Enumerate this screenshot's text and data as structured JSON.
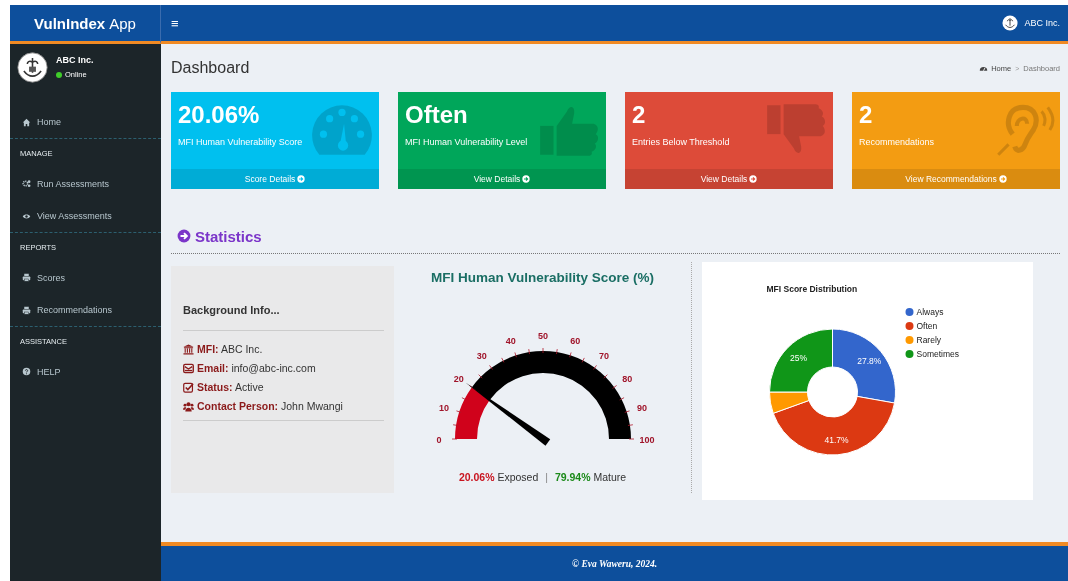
{
  "brand": {
    "bold": "VulnIndex",
    "rest": "App"
  },
  "topbar": {
    "menu_glyph": "≡",
    "user": "ABC Inc."
  },
  "sidebar": {
    "user": {
      "name": "ABC Inc.",
      "status": "Online",
      "online": true
    },
    "menu": [
      {
        "kind": "home",
        "label": "Home"
      },
      {
        "kind": "header",
        "label": "MANAGE"
      },
      {
        "kind": "gears",
        "label": "Run Assessments"
      },
      {
        "kind": "eye",
        "label": "View Assessments"
      },
      {
        "kind": "header",
        "label": "REPORTS"
      },
      {
        "kind": "print",
        "label": "Scores"
      },
      {
        "kind": "print",
        "label": "Recommendations"
      },
      {
        "kind": "header",
        "label": "ASSISTANCE"
      },
      {
        "kind": "help",
        "label": "HELP"
      }
    ]
  },
  "page": {
    "title": "Dashboard",
    "breadcrumb": [
      {
        "label": "Home"
      },
      {
        "label": "Dashboard"
      }
    ],
    "separator": ">"
  },
  "cards": [
    {
      "kind": "gauge",
      "value": "20.06%",
      "label": "MFI Human Vulnerability Score",
      "link": "Score Details",
      "color": "#00c0ef"
    },
    {
      "kind": "thumbs-up",
      "value": "Often",
      "label": "MFI Human Vulnerability Level",
      "link": "View Details",
      "color": "#00a65a"
    },
    {
      "kind": "thumbs-down",
      "value": "2",
      "label": "Entries Below Threshold",
      "link": "View Details",
      "color": "#dd4b39"
    },
    {
      "kind": "ear",
      "value": "2",
      "label": "Recommendations",
      "link": "View Recommendations",
      "color": "#f39c12"
    }
  ],
  "statistics": {
    "title": "Statistics"
  },
  "background_info": {
    "title": "Background Info...",
    "fields": [
      {
        "kind": "bank",
        "label": "MFI:",
        "value": "ABC Inc."
      },
      {
        "kind": "envelope",
        "label": "Email:",
        "value": "info@abc-inc.com"
      },
      {
        "kind": "check",
        "label": "Status:",
        "value": "Active"
      },
      {
        "kind": "users",
        "label": "Contact Person:",
        "value": "John Mwangi"
      }
    ]
  },
  "gauge": {
    "title": "MFI Human Vulnerability Score (%)",
    "level": 0.2006,
    "ticks": [
      "0",
      "10",
      "20",
      "30",
      "40",
      "50",
      "60",
      "70",
      "80",
      "90",
      "100"
    ],
    "exposed": {
      "value": "20.06%",
      "label": "Exposed"
    },
    "separator": "|",
    "mature": {
      "value": "79.94%",
      "label": "Mature"
    }
  },
  "distribution": {
    "chart_data": {
      "type": "donut",
      "title": "MFI Score Distribution",
      "categories": [
        "Always",
        "Often",
        "Rarely",
        "Sometimes"
      ],
      "values": [
        27.8,
        41.7,
        5.5,
        25
      ],
      "legend": "right",
      "colors": [
        "#3366cc",
        "#dc3912",
        "#ff9900",
        "#109618"
      ],
      "value_labels": [
        "27.8%",
        "41.7%",
        null,
        "25%"
      ]
    }
  },
  "footer": {
    "text": "© Eva Waweru, 2024."
  }
}
